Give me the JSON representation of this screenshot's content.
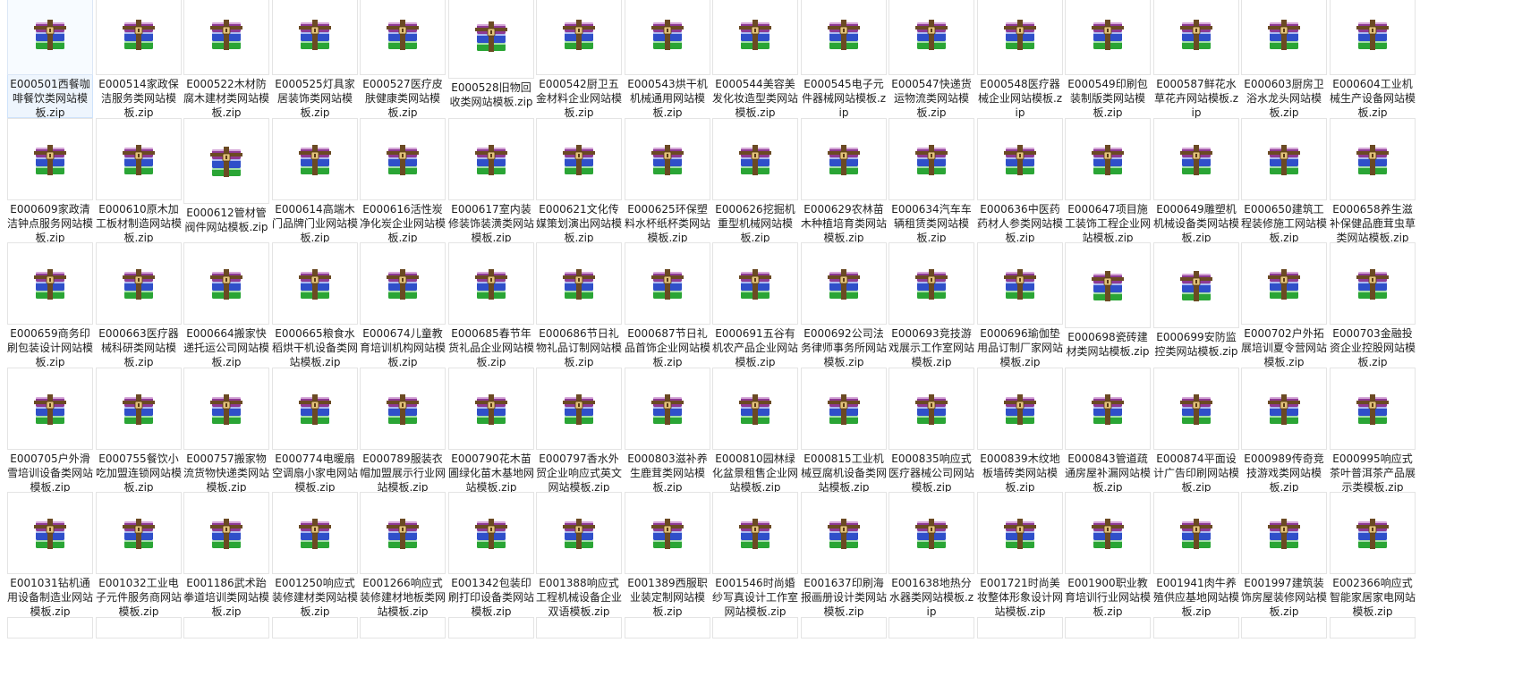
{
  "view": {
    "item_icon": "winrar-archive-icon",
    "colors": {
      "book_purple": "#8e3a94",
      "book_blue": "#2f4fc9",
      "book_green": "#2aa535",
      "strap": "#6b4a23",
      "selected_bg": "#eef5fd"
    }
  },
  "files": [
    {
      "name": "E000501西餐咖啡餐饮类网站模板.zip",
      "selected": true
    },
    {
      "name": "E000514家政保洁服务类网站模板.zip"
    },
    {
      "name": "E000522木材防腐木建材类网站模板.zip"
    },
    {
      "name": "E000525灯具家居装饰类网站模板.zip"
    },
    {
      "name": "E000527医疗皮肤健康类网站模板.zip"
    },
    {
      "name": "E000528旧物回收类网站模板.zip"
    },
    {
      "name": "E000542厨卫五金材料企业网站模板.zip"
    },
    {
      "name": "E000543烘干机机械通用网站模板.zip"
    },
    {
      "name": "E000544美容美发化妆造型类网站模板.zip"
    },
    {
      "name": "E000545电子元件器械网站模板.zip"
    },
    {
      "name": "E000547快递货运物流类网站模板.zip"
    },
    {
      "name": "E000548医疗器械企业网站模板.zip"
    },
    {
      "name": "E000549印刷包装制版类网站模板.zip"
    },
    {
      "name": "E000587鲜花水草花卉网站模板.zip"
    },
    {
      "name": "E000603厨房卫浴水龙头网站模板.zip"
    },
    {
      "name": "E000604工业机械生产设备网站模板.zip"
    },
    {
      "name": "E000609家政清洁钟点服务网站模板.zip"
    },
    {
      "name": "E000610原木加工板材制造网站模板.zip"
    },
    {
      "name": "E000612管材管阀件网站模板.zip"
    },
    {
      "name": "E000614高端木门品牌门业网站模板.zip"
    },
    {
      "name": "E000616活性炭净化炭企业网站模板.zip"
    },
    {
      "name": "E000617室内装修装饰装潢类网站模板.zip"
    },
    {
      "name": "E000621文化传媒策划演出网站模板.zip"
    },
    {
      "name": "E000625环保塑料水杯纸杯类网站模板.zip"
    },
    {
      "name": "E000626挖掘机重型机械网站模板.zip"
    },
    {
      "name": "E000629农林苗木种植培育类网站模板.zip"
    },
    {
      "name": "E000634汽车车辆租赁类网站模板.zip"
    },
    {
      "name": "E000636中医药药材人参类网站模板.zip"
    },
    {
      "name": "E000647项目施工装饰工程企业网站模板.zip"
    },
    {
      "name": "E000649雕塑机机械设备类网站模板.zip"
    },
    {
      "name": "E000650建筑工程装修施工网站模板.zip"
    },
    {
      "name": "E000658养生滋补保健品鹿茸虫草类网站模板.zip"
    },
    {
      "name": "E000659商务印刷包装设计网站模板.zip"
    },
    {
      "name": "E000663医疗器械科研类网站模板.zip"
    },
    {
      "name": "E000664搬家快递托运公司网站模板.zip"
    },
    {
      "name": "E000665粮食水稻烘干机设备类网站模板.zip"
    },
    {
      "name": "E000674儿童教育培训机构网站模板.zip"
    },
    {
      "name": "E000685春节年货礼品企业网站模板.zip"
    },
    {
      "name": "E000686节日礼物礼品订制网站模板.zip"
    },
    {
      "name": "E000687节日礼品首饰企业网站模板.zip"
    },
    {
      "name": "E000691五谷有机农产品企业网站模板.zip"
    },
    {
      "name": "E000692公司法务律师事务所网站模板.zip"
    },
    {
      "name": "E000693竞技游戏展示工作室网站模板.zip"
    },
    {
      "name": "E000696瑜伽垫用品订制厂家网站模板.zip"
    },
    {
      "name": "E000698瓷砖建材类网站模板.zip"
    },
    {
      "name": "E000699安防监控类网站模板.zip"
    },
    {
      "name": "E000702户外拓展培训夏令营网站模板.zip"
    },
    {
      "name": "E000703金融投资企业控股网站模板.zip"
    },
    {
      "name": "E000705户外滑雪培训设备类网站模板.zip"
    },
    {
      "name": "E000755餐饮小吃加盟连锁网站模板.zip"
    },
    {
      "name": "E000757搬家物流货物快递类网站模板.zip"
    },
    {
      "name": "E000774电暖扇空调扇小家电网站模板.zip"
    },
    {
      "name": "E000789服装衣帽加盟展示行业网站模板.zip"
    },
    {
      "name": "E000790花木苗圃绿化苗木基地网站模板.zip"
    },
    {
      "name": "E000797香水外贸企业响应式英文网站模板.zip"
    },
    {
      "name": "E000803滋补养生鹿茸类网站模板.zip"
    },
    {
      "name": "E000810园林绿化盆景租售企业网站模板.zip"
    },
    {
      "name": "E000815工业机械豆腐机设备类网站模板.zip"
    },
    {
      "name": "E000835响应式医疗器械公司网站模板.zip"
    },
    {
      "name": "E000839木纹地板墙砖类网站模板.zip"
    },
    {
      "name": "E000843管道疏通房屋补漏网站模板.zip"
    },
    {
      "name": "E000874平面设计广告印刷网站模板.zip"
    },
    {
      "name": "E000989传奇竞技游戏类网站模板.zip"
    },
    {
      "name": "E000995响应式茶叶普洱茶产品展示类模板.zip"
    },
    {
      "name": "E001031钻机通用设备制造业网站模板.zip"
    },
    {
      "name": "E001032工业电子元件服务商网站模板.zip"
    },
    {
      "name": "E001186武术跆拳道培训类网站模板.zip"
    },
    {
      "name": "E001250响应式装修建材类网站模板.zip"
    },
    {
      "name": "E001266响应式装修建材地板类网站模板.zip"
    },
    {
      "name": "E001342包装印刷打印设备类网站模板.zip"
    },
    {
      "name": "E001388响应式工程机械设备企业双语模板.zip"
    },
    {
      "name": "E001389西服职业装定制网站模板.zip"
    },
    {
      "name": "E001546时尚婚纱写真设计工作室网站模板.zip"
    },
    {
      "name": "E001637印刷海报画册设计类网站模板.zip"
    },
    {
      "name": "E001638地热分水器类网站模板.zip"
    },
    {
      "name": "E001721时尚美妆整体形象设计网站模板.zip"
    },
    {
      "name": "E001900职业教育培训行业网站模板.zip"
    },
    {
      "name": "E001941肉牛养殖供应基地网站模板.zip"
    },
    {
      "name": "E001997建筑装饰房屋装修网站模板.zip"
    },
    {
      "name": "E002366响应式智能家居家电网站模板.zip"
    }
  ]
}
